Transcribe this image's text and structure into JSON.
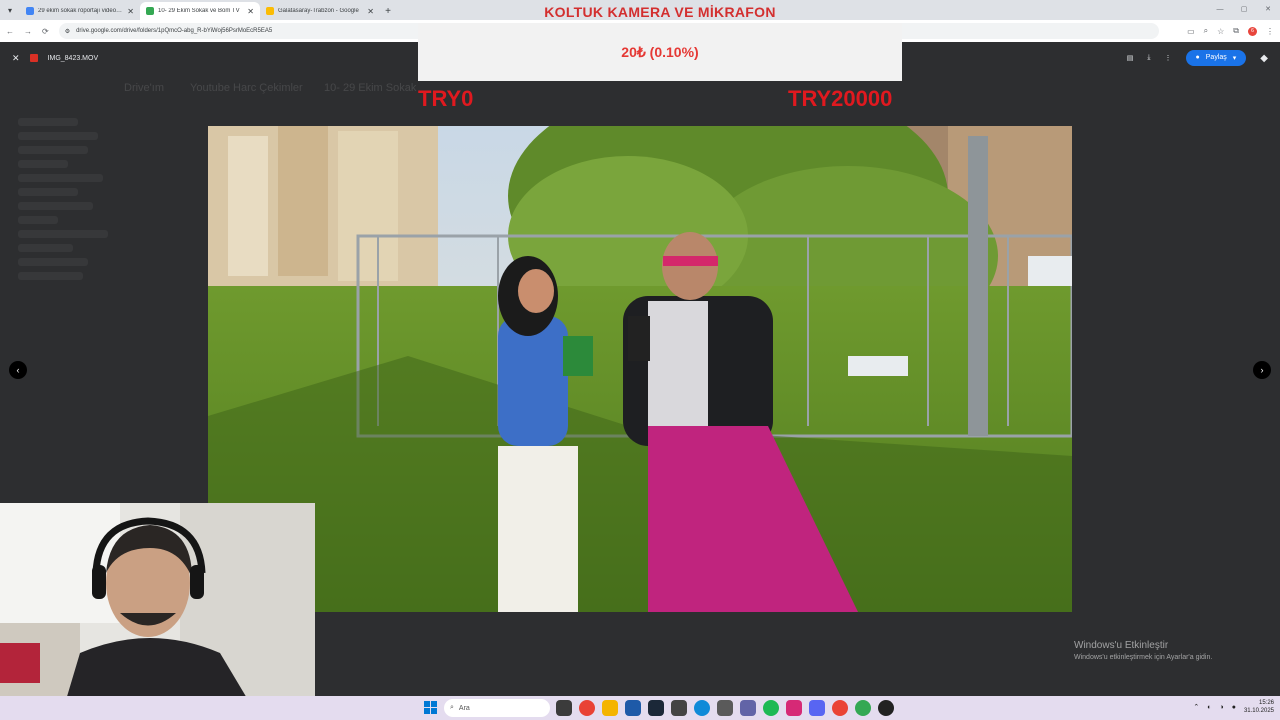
{
  "browser": {
    "tabs": [
      {
        "title": "29 ekim sokak röportajı video t...",
        "color": "#4285f4",
        "active": false
      },
      {
        "title": "10- 29 Ekim Sokak ve Bom TV",
        "color": "#34a853",
        "active": true
      },
      {
        "title": "Galatasaray-Trabzon - Google",
        "color": "#fbbc04",
        "active": false
      }
    ],
    "url": "drive.google.com/drive/folders/1pQmcO-abg_R-bYiWoj56PsrMoEcR5EA5",
    "extension_badge": "6"
  },
  "viewer": {
    "file_name": "IMG_8423.MOV",
    "share_label": "Paylaş",
    "ghost_breadcrumb": [
      "Drive'ım",
      "Youtube Harc Çekimler",
      "10- 29 Ekim Sokak"
    ]
  },
  "overlay": {
    "title": "KOLTUK KAMERA VE MİKRAFON",
    "donation": "20₺ (0.10%)",
    "range_min": "TRY0",
    "range_max": "TRY20000",
    "progress_fraction": 0.001
  },
  "watermark": {
    "line1": "Windows'u Etkinleştir",
    "line2": "Windows'u etkinleştirmek için Ayarlar'a gidin."
  },
  "taskbar": {
    "search_placeholder": "Ara",
    "time": "15:26",
    "date": "31.10.2025"
  },
  "icons": [
    "close-icon",
    "download-icon",
    "more-icon",
    "chevron-left-icon",
    "chevron-right-icon",
    "windows-icon",
    "search-icon"
  ]
}
